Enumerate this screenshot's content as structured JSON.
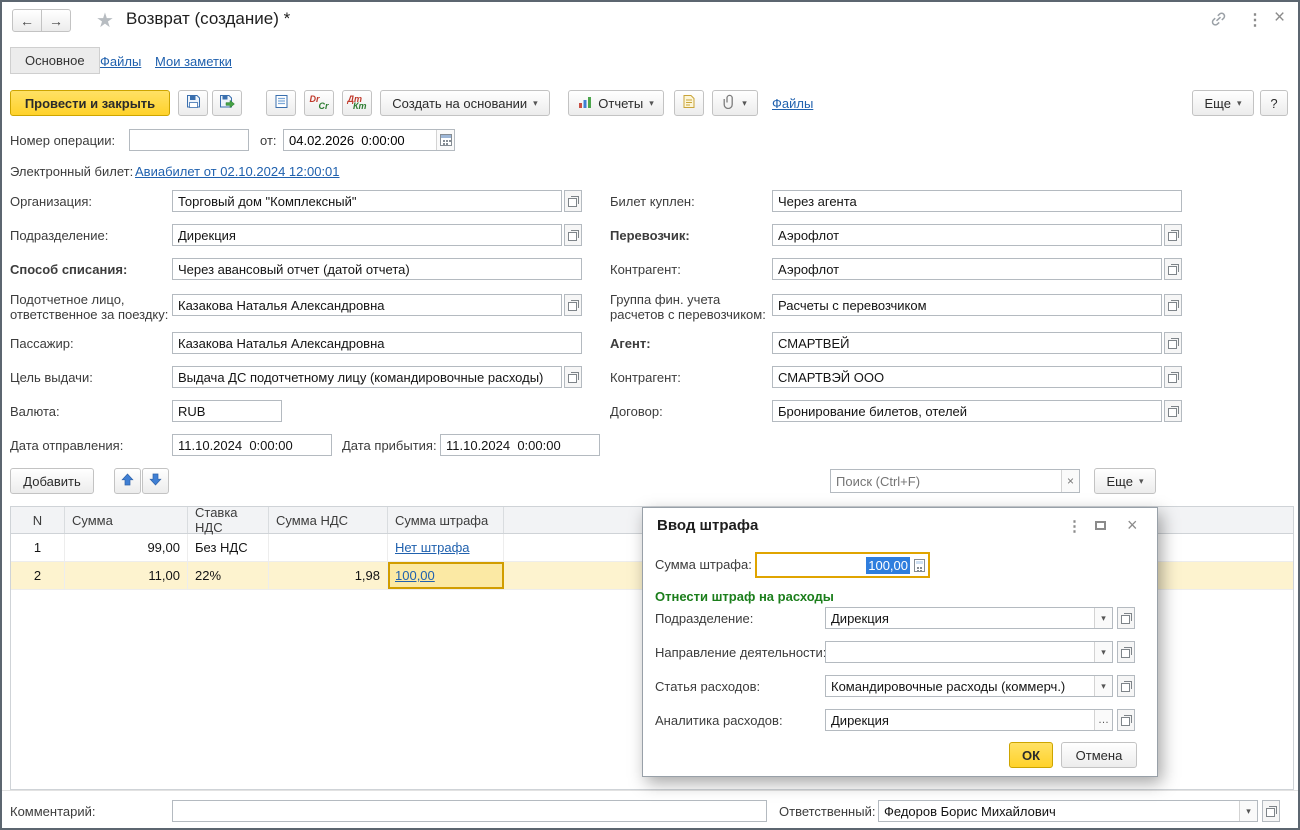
{
  "window": {
    "title": "Возврат (создание) *"
  },
  "icons": {
    "back": "←",
    "forward": "→",
    "star": "★",
    "more_vert": "⋮",
    "close": "×",
    "dropdown": "▾",
    "clear": "×",
    "ellipsis": "…"
  },
  "tabs": {
    "main": "Основное",
    "files": "Файлы",
    "notes": "Мои заметки"
  },
  "toolbar": {
    "post_close": "Провести и закрыть",
    "create_based": "Создать на основании",
    "reports": "Отчеты",
    "files": "Файлы",
    "more": "Еще",
    "help": "?",
    "dr": "Dr",
    "cr": "Cr",
    "dt": "Дт",
    "kt": "Кт"
  },
  "header": {
    "op_number_label": "Номер операции:",
    "op_number_value": "",
    "from_label": "от:",
    "op_date": "04.02.2026  0:00:00",
    "eticket_label": "Электронный билет:",
    "eticket_link": "Авиабилет от 02.10.2024 12:00:01"
  },
  "fields": {
    "org": {
      "label": "Организация:",
      "value": "Торговый дом \"Комплексный\""
    },
    "dept": {
      "label": "Подразделение:",
      "value": "Дирекция"
    },
    "writeoff": {
      "label": "Способ списания:",
      "value": "Через авансовый отчет (датой отчета)"
    },
    "accountable": {
      "label": "Подотчетное лицо, ответственное за поездку:",
      "value": "Казакова Наталья Александровна"
    },
    "passenger": {
      "label": "Пассажир:",
      "value": "Казакова Наталья Александровна"
    },
    "purpose": {
      "label": "Цель выдачи:",
      "value": "Выдача ДС подотчетному лицу (командировочные расходы)"
    },
    "currency": {
      "label": "Валюта:",
      "value": "RUB"
    },
    "dep_date": {
      "label": "Дата отправления:",
      "value": "11.10.2024  0:00:00"
    },
    "arr_date": {
      "label": "Дата прибытия:",
      "value": "11.10.2024  0:00:00"
    },
    "ticket_bought": {
      "label": "Билет куплен:",
      "value": "Через агента"
    },
    "carrier": {
      "label": "Перевозчик:",
      "value": "Аэрофлот"
    },
    "carrier_contragent": {
      "label": "Контрагент:",
      "value": "Аэрофлот"
    },
    "fin_group": {
      "label": "Группа фин. учета расчетов с перевозчиком:",
      "value": "Расчеты с перевозчиком"
    },
    "agent": {
      "label": "Агент:",
      "value": "СМАРТВЕЙ"
    },
    "agent_contragent": {
      "label": "Контрагент:",
      "value": "СМАРТВЭЙ ООО"
    },
    "contract": {
      "label": "Договор:",
      "value": "Бронирование билетов, отелей"
    }
  },
  "table_bar": {
    "add": "Добавить",
    "search_placeholder": "Поиск (Ctrl+F)",
    "more": "Еще"
  },
  "table": {
    "headers": {
      "n": "N",
      "sum": "Сумма",
      "vat_rate": "Ставка НДС",
      "vat_sum": "Сумма НДС",
      "fine": "Сумма штрафа"
    },
    "rows": [
      {
        "n": "1",
        "sum": "99,00",
        "vat_rate": "Без НДС",
        "vat_sum": "",
        "fine": "Нет штрафа"
      },
      {
        "n": "2",
        "sum": "11,00",
        "vat_rate": "22%",
        "vat_sum": "1,98",
        "fine": "100,00"
      }
    ]
  },
  "dialog": {
    "title": "Ввод штрафа",
    "fine_label": "Сумма штрафа:",
    "fine_value": "100,00",
    "section": "Отнести штраф на расходы",
    "dept_label": "Подразделение:",
    "dept_value": "Дирекция",
    "direction_label": "Направление деятельности:",
    "direction_value": "",
    "expense_label": "Статья расходов:",
    "expense_value": "Командировочные расходы (коммерч.)",
    "analytics_label": "Аналитика расходов:",
    "analytics_value": "Дирекция",
    "ok": "ОК",
    "cancel": "Отмена"
  },
  "footer": {
    "comment_label": "Комментарий:",
    "comment_value": "",
    "responsible_label": "Ответственный:",
    "responsible_value": "Федоров Борис Михайлович"
  },
  "colors": {
    "accent_yellow": "#ffd42e",
    "link_blue": "#2061ae",
    "selected_row": "#fdf3cf",
    "section_green": "#1b7e1b",
    "focus_border": "#e0a400"
  }
}
